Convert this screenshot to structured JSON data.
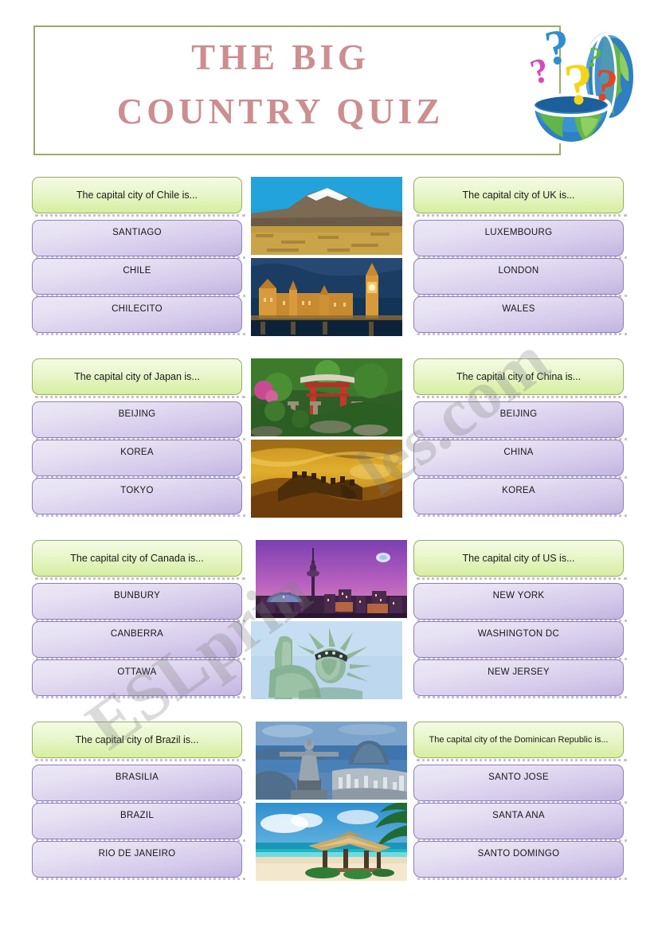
{
  "header": {
    "title": "THE BIG\nCOUNTRY QUIZ",
    "title_color": "#cc8e90",
    "border_color": "#9aab66",
    "clipart_name": "open-globe-with-question-marks"
  },
  "watermark": {
    "line1": "ESLprin",
    "line2": "les.com"
  },
  "theme": {
    "question_border": "#9aab66",
    "question_fill_top": "#f4fbe4",
    "question_fill_bottom": "#d6eea0",
    "answer_border": "#8f7fb5",
    "answer_fill_top": "#ece8f6",
    "answer_fill_bottom": "#c2b4e0"
  },
  "rows": [
    {
      "left": {
        "question": "The capital city of Chile is...",
        "answers": [
          "SANTIAGO",
          "CHILE",
          "CHILECITO"
        ]
      },
      "right": {
        "question": "The capital city of UK is...",
        "answers": [
          "LUXEMBOURG",
          "LONDON",
          "WALES"
        ]
      },
      "pictures": [
        {
          "caption": "snow-capped-andes-mountain-photo"
        },
        {
          "caption": "big-ben-westminster-palace-photo"
        }
      ]
    },
    {
      "left": {
        "question": "The capital city of Japan is...",
        "answers": [
          "BEIJING",
          "KOREA",
          "TOKYO"
        ]
      },
      "right": {
        "question": "The capital city of China is...",
        "answers": [
          "BEIJING",
          "CHINA",
          "KOREA"
        ]
      },
      "pictures": [
        {
          "caption": "japanese-torii-gate-garden-photo"
        },
        {
          "caption": "great-wall-of-china-golden-photo"
        }
      ]
    },
    {
      "left": {
        "question": "The capital city of Canada is...",
        "answers": [
          "BUNBURY",
          "CANBERRA",
          "OTTAWA"
        ]
      },
      "right": {
        "question": "The capital city of US is...",
        "answers": [
          "NEW YORK",
          "WASHINGTON DC",
          "NEW JERSEY"
        ]
      },
      "pictures": [
        {
          "caption": "toronto-cn-tower-skyline-photo"
        },
        {
          "caption": "statue-of-liberty-photo"
        }
      ]
    },
    {
      "left": {
        "question": "The capital city of Brazil is...",
        "answers": [
          "BRASILIA",
          "BRAZIL",
          "RIO DE JANEIRO"
        ]
      },
      "right": {
        "question": "The capital city of the Dominican Republic is...",
        "answers": [
          "SANTO JOSE",
          "SANTA ANA",
          "SANTO DOMINGO"
        ]
      },
      "pictures": [
        {
          "caption": "christ-the-redeemer-rio-photo"
        },
        {
          "caption": "tropical-beach-thatched-gazebo-photo"
        }
      ]
    }
  ]
}
